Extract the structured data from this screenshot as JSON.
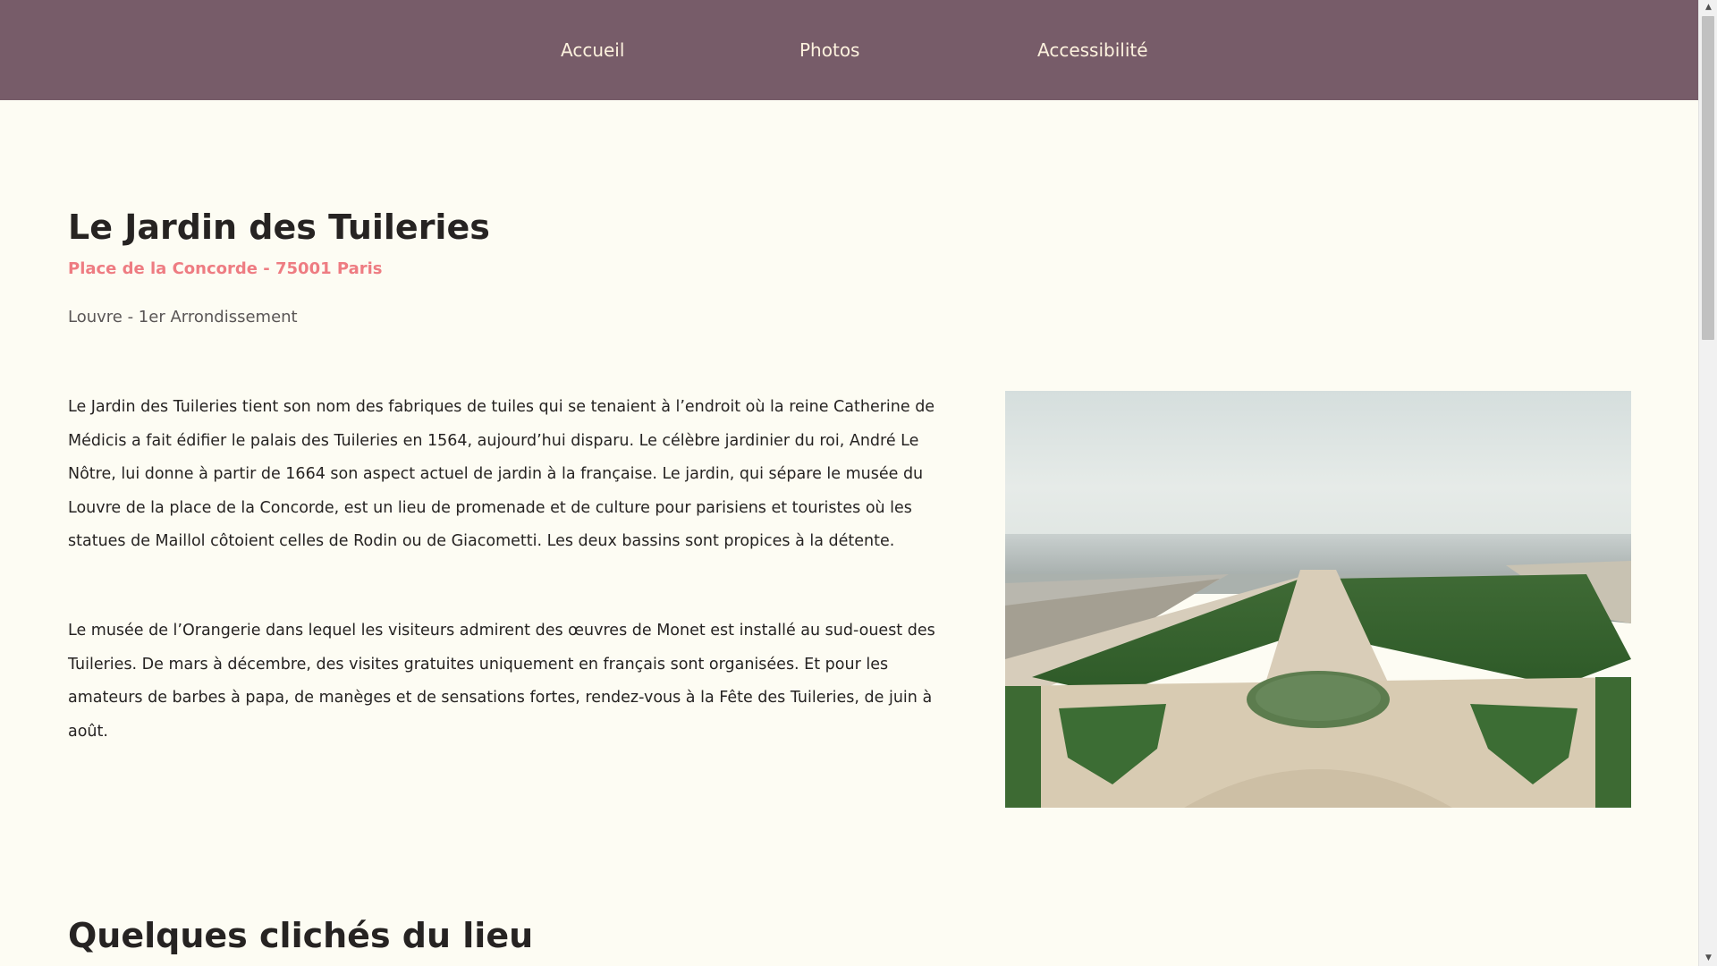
{
  "nav": {
    "items": [
      {
        "label": "Accueil"
      },
      {
        "label": "Photos"
      },
      {
        "label": "Accessibilité"
      }
    ]
  },
  "main": {
    "title": "Le Jardin des Tuileries",
    "address": "Place de la Concorde - 75001 Paris",
    "district": "Louvre - 1er Arrondissement",
    "paragraphs": [
      "Le Jardin des Tuileries tient son nom des fabriques de tuiles qui se tenaient à l’endroit où la reine Catherine de Médicis a fait édifier le palais des Tuileries en 1564, aujourd’hui disparu. Le célèbre jardinier du roi, André Le Nôtre, lui donne à partir de 1664 son aspect actuel de jardin à la française. Le jardin, qui sépare le musée du Louvre de la place de la Concorde, est un lieu de promenade et de culture pour parisiens et touristes où les statues de Maillol côtoient celles de Rodin ou de Giacometti. Les deux bassins sont propices à la détente.",
      "Le musée de l’Orangerie dans lequel les visiteurs admirent des œuvres de Monet est installé au sud-ouest des Tuileries. De mars à décembre, des visites gratuites uniquement en français sont organisées. Et pour les amateurs de barbes à papa, de manèges et de sensations fortes, rendez-vous à la Fête des Tuileries, de juin à août."
    ],
    "section_title": "Quelques clichés du lieu"
  },
  "colors": {
    "nav_bg": "#775c69",
    "nav_text": "#fdf2de",
    "page_bg": "#fdfcf3",
    "accent": "#ee7c82",
    "text": "#262322"
  }
}
